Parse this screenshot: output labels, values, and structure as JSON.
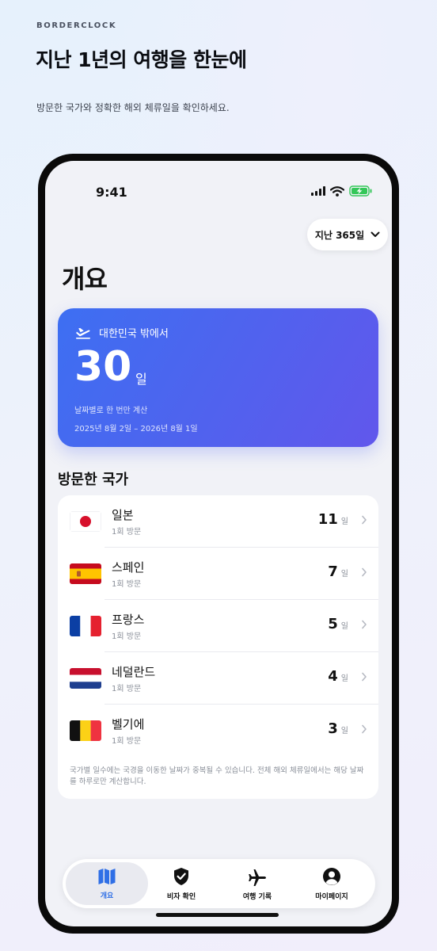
{
  "brand": "BORDERCLOCK",
  "headline": "지난 1년의 여행을 한눈에",
  "subtitle": "방문한 국가와 정확한 해외 체류일을 확인하세요.",
  "status": {
    "time": "9:41"
  },
  "period_selector": {
    "label": "지난 365일"
  },
  "page_title": "개요",
  "summary": {
    "label": "대한민국 밖에서",
    "days": "30",
    "unit": "일",
    "note": "날짜별로 한 번만 계산",
    "range": "2025년 8월 2일 – 2026년 8월 1일"
  },
  "visited_title": "방문한 국가",
  "countries": [
    {
      "name": "일본",
      "visits": "1회 방문",
      "days": "11",
      "unit": "일"
    },
    {
      "name": "스페인",
      "visits": "1회 방문",
      "days": "7",
      "unit": "일"
    },
    {
      "name": "프랑스",
      "visits": "1회 방문",
      "days": "5",
      "unit": "일"
    },
    {
      "name": "네덜란드",
      "visits": "1회 방문",
      "days": "4",
      "unit": "일"
    },
    {
      "name": "벨기에",
      "visits": "1회 방문",
      "days": "3",
      "unit": "일"
    }
  ],
  "footnote": "국가별 일수에는 국경을 이동한 날짜가 중복될 수 있습니다. 전체 해외 체류일에서는 해당 날짜를 하루로만 계산합니다.",
  "tabs": [
    {
      "label": "개요",
      "icon": "map-icon",
      "active": true
    },
    {
      "label": "비자 확인",
      "icon": "shield-check-icon",
      "active": false
    },
    {
      "label": "여행 기록",
      "icon": "airplane-icon",
      "active": false
    },
    {
      "label": "마이페이지",
      "icon": "profile-icon",
      "active": false
    }
  ],
  "colors": {
    "accent": "#2f6fe6",
    "hero_start": "#3d6ff2",
    "hero_end": "#6157ec",
    "battery": "#34c759"
  }
}
